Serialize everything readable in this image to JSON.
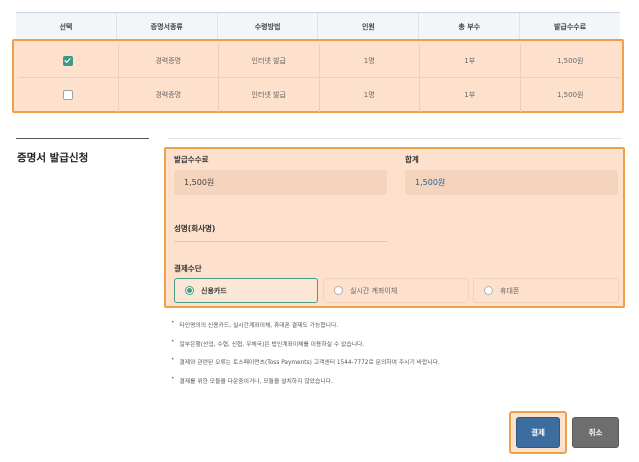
{
  "table": {
    "headers": [
      "선택",
      "증명서종류",
      "수령방법",
      "인원",
      "총 부수",
      "발급수수료"
    ],
    "rows": [
      {
        "checked": true,
        "type": "경력증명",
        "method": "인터넷 발급",
        "people": "1명",
        "copies": "1부",
        "fee": "1,500원"
      },
      {
        "checked": false,
        "type": "경력증명",
        "method": "인터넷 발급",
        "people": "1명",
        "copies": "1부",
        "fee": "1,500원"
      }
    ]
  },
  "section": {
    "title": "증명서 발급신청"
  },
  "form": {
    "fee_label": "발급수수료",
    "fee_value": "1,500원",
    "sum_label": "합계",
    "sum_value": "1,500원",
    "name_label": "성명(회사명)",
    "payment_label": "결제수단",
    "payment_options": [
      {
        "label": "신용카드",
        "selected": true
      },
      {
        "label": "실시간 계좌이체",
        "selected": false
      },
      {
        "label": "휴대폰",
        "selected": false
      }
    ]
  },
  "notes": [
    "타인명의의 신용카드, 실시간계좌이체, 휴대폰 결제도 가능합니다.",
    "일부은행(산업, 수협, 신협, 우체국)은 법인계좌이체를 이용하실 수 없습니다.",
    "결제와 관련된 오류는 토스페이먼츠(Toss Payments) 고객센터 1544-7772로 문의하여 주시기 바랍니다.",
    "결제를 위한 모듈을 다운중이거나, 모듈을 설치하지 않았습니다."
  ],
  "buttons": {
    "pay": "결제",
    "cancel": "취소"
  },
  "colors": {
    "accent": "#3c9a83",
    "highlight": "#f0a04b",
    "primary_button": "#3d6d9e",
    "secondary_button": "#6e6e6e"
  }
}
